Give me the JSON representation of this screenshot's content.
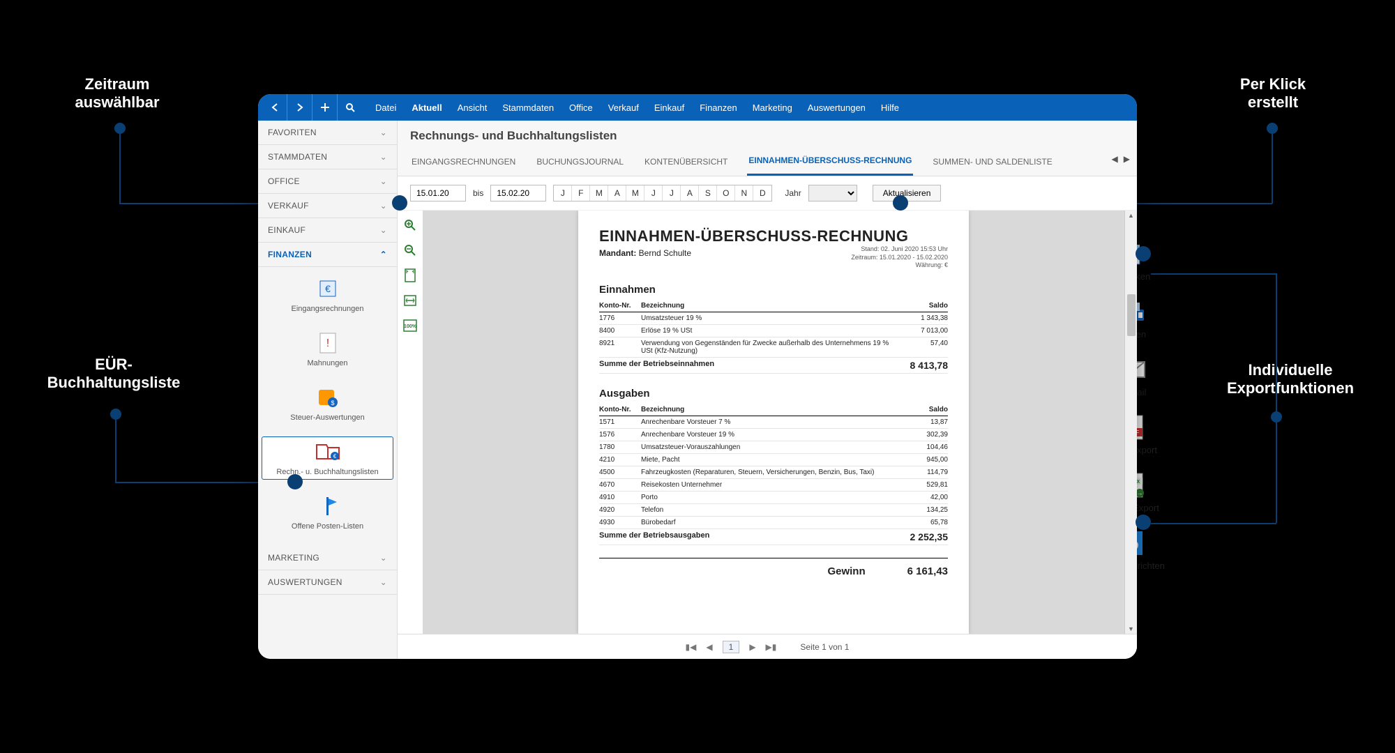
{
  "callouts": {
    "tl": "Zeitraum\nauswählbar",
    "ml": "EÜR-\nBuchhaltungsliste",
    "tr": "Per Klick\nerstellt",
    "mr": "Individuelle\nExportfunktionen"
  },
  "menu": {
    "items": [
      "Datei",
      "Aktuell",
      "Ansicht",
      "Stammdaten",
      "Office",
      "Verkauf",
      "Einkauf",
      "Finanzen",
      "Marketing",
      "Auswertungen",
      "Hilfe"
    ],
    "active": "Aktuell"
  },
  "sidebar": {
    "sections": [
      "FAVORITEN",
      "STAMMDATEN",
      "OFFICE",
      "VERKAUF",
      "EINKAUF",
      "FINANZEN",
      "MARKETING",
      "AUSWERTUNGEN"
    ],
    "open": "FINANZEN",
    "items": [
      {
        "label": "Eingangsrechnungen",
        "icon": "euro"
      },
      {
        "label": "Mahnungen",
        "icon": "warn"
      },
      {
        "label": "Steuer-Auswertungen",
        "icon": "tax"
      },
      {
        "label": "Rechn.- u. Buchhaltungslisten",
        "icon": "book",
        "active": true
      },
      {
        "label": "Offene Posten-Listen",
        "icon": "flag"
      }
    ]
  },
  "page_title": "Rechnungs- und Buchhaltungslisten",
  "tabs": {
    "items": [
      "EINGANGSRECHNUNGEN",
      "BUCHUNGSJOURNAL",
      "KONTENÜBERSICHT",
      "EINNAHMEN-ÜBERSCHUSS-RECHNUNG",
      "SUMMEN- UND SALDENLISTE"
    ],
    "active": "EINNAHMEN-ÜBERSCHUSS-RECHNUNG"
  },
  "filter": {
    "from": "15.01.20",
    "bis_label": "bis",
    "to": "15.02.20",
    "months": [
      "J",
      "F",
      "M",
      "A",
      "M",
      "J",
      "J",
      "A",
      "S",
      "O",
      "N",
      "D"
    ],
    "year_label": "Jahr",
    "year_value": "",
    "update_btn": "Aktualisieren"
  },
  "report": {
    "title": "EINNAHMEN-ÜBERSCHUSS-RECHNUNG",
    "mandant_label": "Mandant:",
    "mandant_name": "Bernd Schulte",
    "meta": {
      "stand": "Stand: 02. Juni 2020 15:53 Uhr",
      "zeitraum": "Zeitraum: 15.01.2020 - 15.02.2020",
      "waehrung": "Währung: €"
    },
    "col_konto": "Konto-Nr.",
    "col_bez": "Bezeichnung",
    "col_saldo": "Saldo",
    "einnahmen_hdr": "Einnahmen",
    "einnahmen": [
      {
        "k": "1776",
        "b": "Umsatzsteuer 19 %",
        "s": "1 343,38"
      },
      {
        "k": "8400",
        "b": "Erlöse 19 % USt",
        "s": "7 013,00"
      },
      {
        "k": "8921",
        "b": "Verwendung von Gegenständen für Zwecke außerhalb des Unternehmens 19 % USt (Kfz-Nutzung)",
        "s": "57,40"
      }
    ],
    "einnahmen_sum_label": "Summe der Betriebseinnahmen",
    "einnahmen_sum": "8 413,78",
    "ausgaben_hdr": "Ausgaben",
    "ausgaben": [
      {
        "k": "1571",
        "b": "Anrechenbare Vorsteuer 7 %",
        "s": "13,87"
      },
      {
        "k": "1576",
        "b": "Anrechenbare Vorsteuer 19 %",
        "s": "302,39"
      },
      {
        "k": "1780",
        "b": "Umsatzsteuer-Vorauszahlungen",
        "s": "104,46"
      },
      {
        "k": "4210",
        "b": "Miete, Pacht",
        "s": "945,00"
      },
      {
        "k": "4500",
        "b": "Fahrzeugkosten (Reparaturen, Steuern, Versicherungen, Benzin, Bus, Taxi)",
        "s": "114,79"
      },
      {
        "k": "4670",
        "b": "Reisekosten Unternehmer",
        "s": "529,81"
      },
      {
        "k": "4910",
        "b": "Porto",
        "s": "42,00"
      },
      {
        "k": "4920",
        "b": "Telefon",
        "s": "134,25"
      },
      {
        "k": "4930",
        "b": "Bürobedarf",
        "s": "65,78"
      }
    ],
    "ausgaben_sum_label": "Summe der Betriebsausgaben",
    "ausgaben_sum": "2 252,35",
    "gewinn_label": "Gewinn",
    "gewinn": "6 161,43"
  },
  "pager": {
    "page": "1",
    "info": "Seite 1 von 1"
  },
  "actions": [
    {
      "label": "Drucken",
      "icon": "printer"
    },
    {
      "label": "Faxen",
      "icon": "fax"
    },
    {
      "label": "E-Mail",
      "icon": "mail"
    },
    {
      "label": "PDF-Export",
      "icon": "pdf"
    },
    {
      "label": "Excel-Export",
      "icon": "xlsx"
    },
    {
      "label": "Seite einrichten",
      "icon": "pagesetup"
    }
  ]
}
